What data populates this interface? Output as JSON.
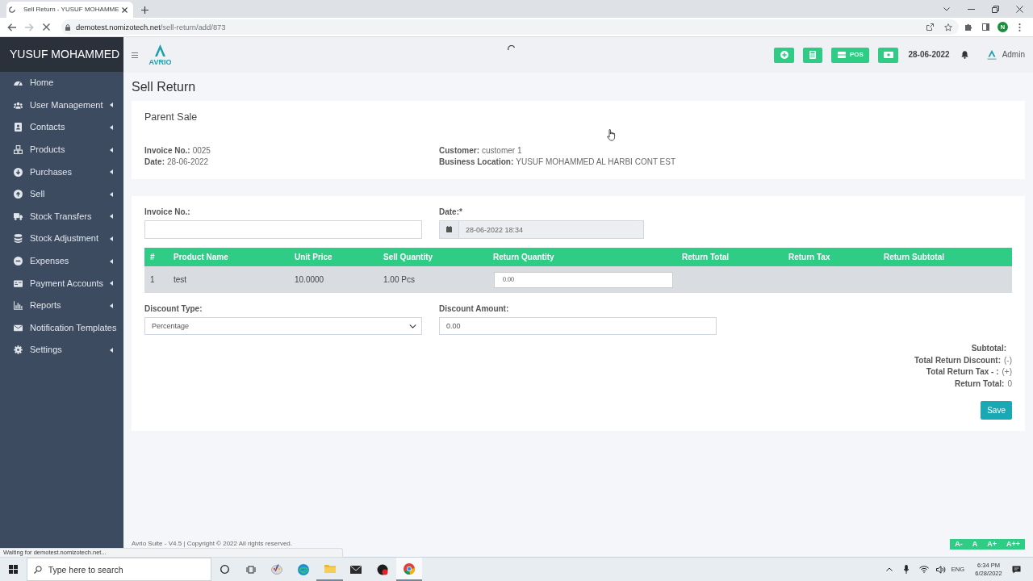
{
  "browser": {
    "tab_title": "Sell Return - YUSUF MOHAMME",
    "url_host": "demotest.nomizotech.net",
    "url_path": "/sell-return/add/873",
    "profile_initial": "N",
    "loading": true,
    "status_text": "Waiting for demotest.nomizotech.net..."
  },
  "sidebar": {
    "brand": "YUSUF MOHAMMED",
    "items": [
      {
        "label": "Home",
        "has_submenu": false
      },
      {
        "label": "User Management",
        "has_submenu": true
      },
      {
        "label": "Contacts",
        "has_submenu": true
      },
      {
        "label": "Products",
        "has_submenu": true
      },
      {
        "label": "Purchases",
        "has_submenu": true
      },
      {
        "label": "Sell",
        "has_submenu": true
      },
      {
        "label": "Stock Transfers",
        "has_submenu": true
      },
      {
        "label": "Stock Adjustment",
        "has_submenu": true
      },
      {
        "label": "Expenses",
        "has_submenu": true
      },
      {
        "label": "Payment Accounts",
        "has_submenu": true
      },
      {
        "label": "Reports",
        "has_submenu": true
      },
      {
        "label": "Notification Templates",
        "has_submenu": false
      },
      {
        "label": "Settings",
        "has_submenu": true
      }
    ]
  },
  "header": {
    "logo_text": "AVRIO",
    "pos_label": "POS",
    "date": "28-06-2022",
    "user": "Admin"
  },
  "page_title": "Sell Return",
  "parent_sale": {
    "title": "Parent Sale",
    "columns": [
      [
        {
          "label": "Invoice No.:",
          "value": "0025"
        },
        {
          "label": "Date:",
          "value": "28-06-2022"
        }
      ],
      [
        {
          "label": "Customer:",
          "value": "customer 1"
        },
        {
          "label": "Business Location:",
          "value": "YUSUF MOHAMMED AL HARBI CONT EST"
        }
      ]
    ]
  },
  "return_form": {
    "invoice_no": {
      "label": "Invoice No.:"
    },
    "date": {
      "label": "Date:*",
      "value": "28-06-2022 18:34",
      "readonly": true
    },
    "table": {
      "columns": [
        "#",
        "Product Name",
        "Unit Price",
        "Sell Quantity",
        "Return Quantity",
        "Return Total",
        "Return Tax",
        "Return Subtotal"
      ],
      "rows": [
        {
          "cells": [
            "1",
            "test",
            "10.0000",
            "1.00 Pcs"
          ],
          "return_quantity": "0.00"
        }
      ]
    },
    "discount_type": {
      "label": "Discount Type:",
      "value": "Percentage"
    },
    "discount_amount": {
      "label": "Discount Amount:",
      "value": "0.00"
    },
    "summary": [
      {
        "label": "Subtotal:"
      },
      {
        "label": "Total Return Discount:",
        "value": "(-)"
      },
      {
        "label": "Total Return Tax - :",
        "value": "(+)"
      },
      {
        "label": "Return Total:",
        "value": "0"
      }
    ],
    "save_label": "Save"
  },
  "footer": {
    "text": "Avrio Suite - V4.5 | Copyright © 2022 All rights reserved.",
    "font_buttons": [
      "A-",
      "A",
      "A+",
      "A++"
    ]
  },
  "taskbar": {
    "search_placeholder": "Type here to search",
    "language": "ENG",
    "time": "6:34 PM",
    "date": "6/28/2022"
  }
}
